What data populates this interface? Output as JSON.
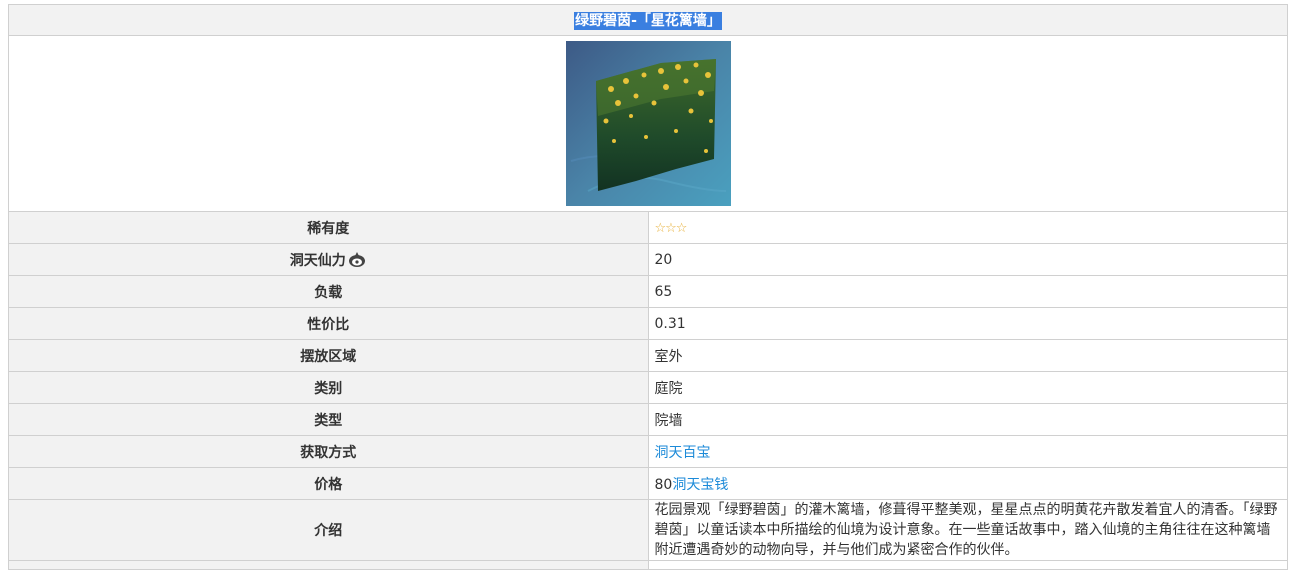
{
  "title": "绿野碧茵-「星花篱墙」",
  "image": {
    "icon": "hedge-wall-image"
  },
  "rows": [
    {
      "label": "稀有度",
      "value": "☆☆☆",
      "type": "stars"
    },
    {
      "label": "洞天仙力",
      "value": "20",
      "type": "text",
      "label_icon": "adeptal-energy-icon"
    },
    {
      "label": "负载",
      "value": "65",
      "type": "text"
    },
    {
      "label": "性价比",
      "value": "0.31",
      "type": "text"
    },
    {
      "label": "摆放区域",
      "value": "室外",
      "type": "text"
    },
    {
      "label": "类别",
      "value": "庭院",
      "type": "text"
    },
    {
      "label": "类型",
      "value": "院墙",
      "type": "text"
    },
    {
      "label": "获取方式",
      "value": "洞天百宝",
      "type": "link"
    },
    {
      "label": "价格",
      "value_prefix": "80",
      "value_link": "洞天宝钱",
      "type": "price"
    },
    {
      "label": "介绍",
      "value": "花园景观「绿野碧茵」的灌木篱墙，修葺得平整美观，星星点点的明黄花卉散发着宜人的清香。「绿野碧茵」以童话读本中所描绘的仙境为设计意象。在一些童话故事中，踏入仙境的主角往往在这种篱墙附近遭遇奇妙的动物向导，并与他们成为紧密合作的伙伴。",
      "type": "text"
    }
  ],
  "colors": {
    "link": "#1c8ad8",
    "header_bg": "#f2f2f2",
    "title_highlight": "#3a7fe0",
    "star": "#e8b23c"
  }
}
